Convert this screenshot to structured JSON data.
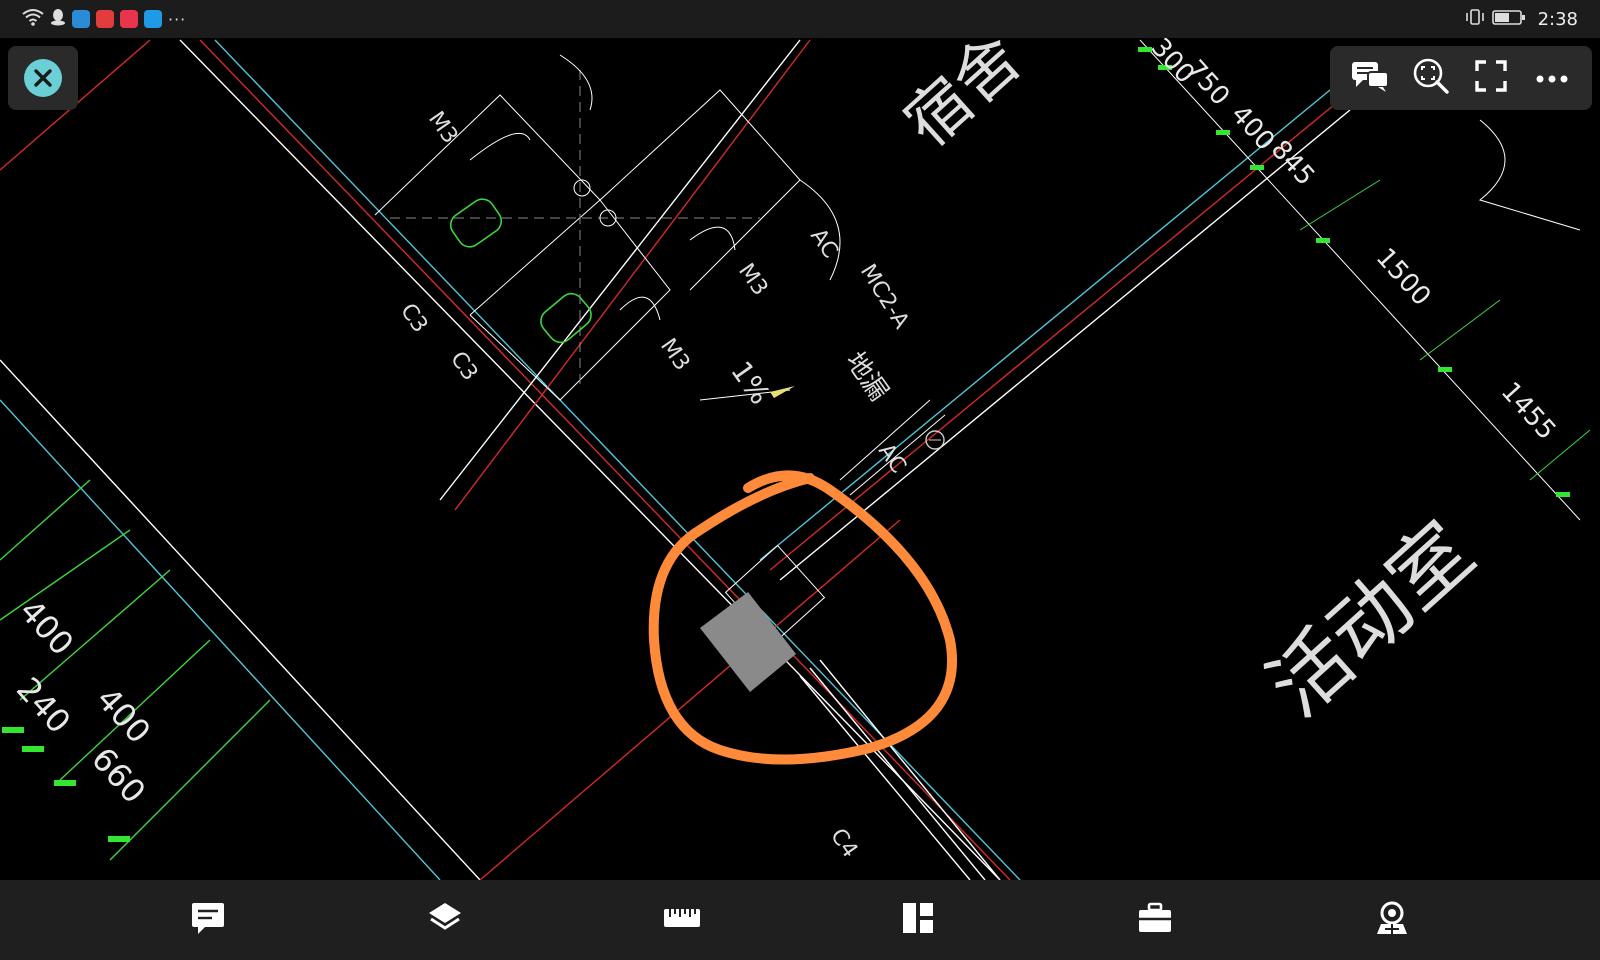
{
  "status_bar": {
    "time": "2:38",
    "more": "···"
  },
  "drawing": {
    "labels": {
      "m3_a": "M3",
      "m3_b": "M3",
      "m3_c": "M3",
      "c3_a": "C3",
      "c3_b": "C3",
      "c4": "C4",
      "ac_a": "AC",
      "ac_b": "AC",
      "mc2a": "MC2-A",
      "slope": "1%",
      "floor_drain": "地漏",
      "room_dorm": "宿舍",
      "room_activity": "活动室"
    },
    "dimensions_right": {
      "d1": "300",
      "d2": "750",
      "d3": "400",
      "d4": "845",
      "d5": "1500",
      "d6": "1455"
    },
    "dimensions_left": {
      "d1": "400",
      "d2": "240",
      "d3": "400",
      "d4": "660"
    }
  },
  "colors": {
    "accent_close": "#6ad0d6",
    "annotation_orange": "#ff8a3a",
    "wall_white": "#ffffff",
    "wall_cyan": "#4fc6d8",
    "wall_red": "#d42a2a",
    "dim_green": "#32e632",
    "fixture_green": "#3ad83a"
  },
  "icons": {
    "close": "close-icon",
    "comments": "comments-icon",
    "zoom_fit": "zoom-fit-icon",
    "fullscreen": "fullscreen-icon",
    "more": "more-icon",
    "annotate": "annotate-icon",
    "layers": "layers-icon",
    "measure": "ruler-icon",
    "layout": "layout-icon",
    "toolbox": "toolbox-icon",
    "viewer3d": "3d-view-icon"
  }
}
